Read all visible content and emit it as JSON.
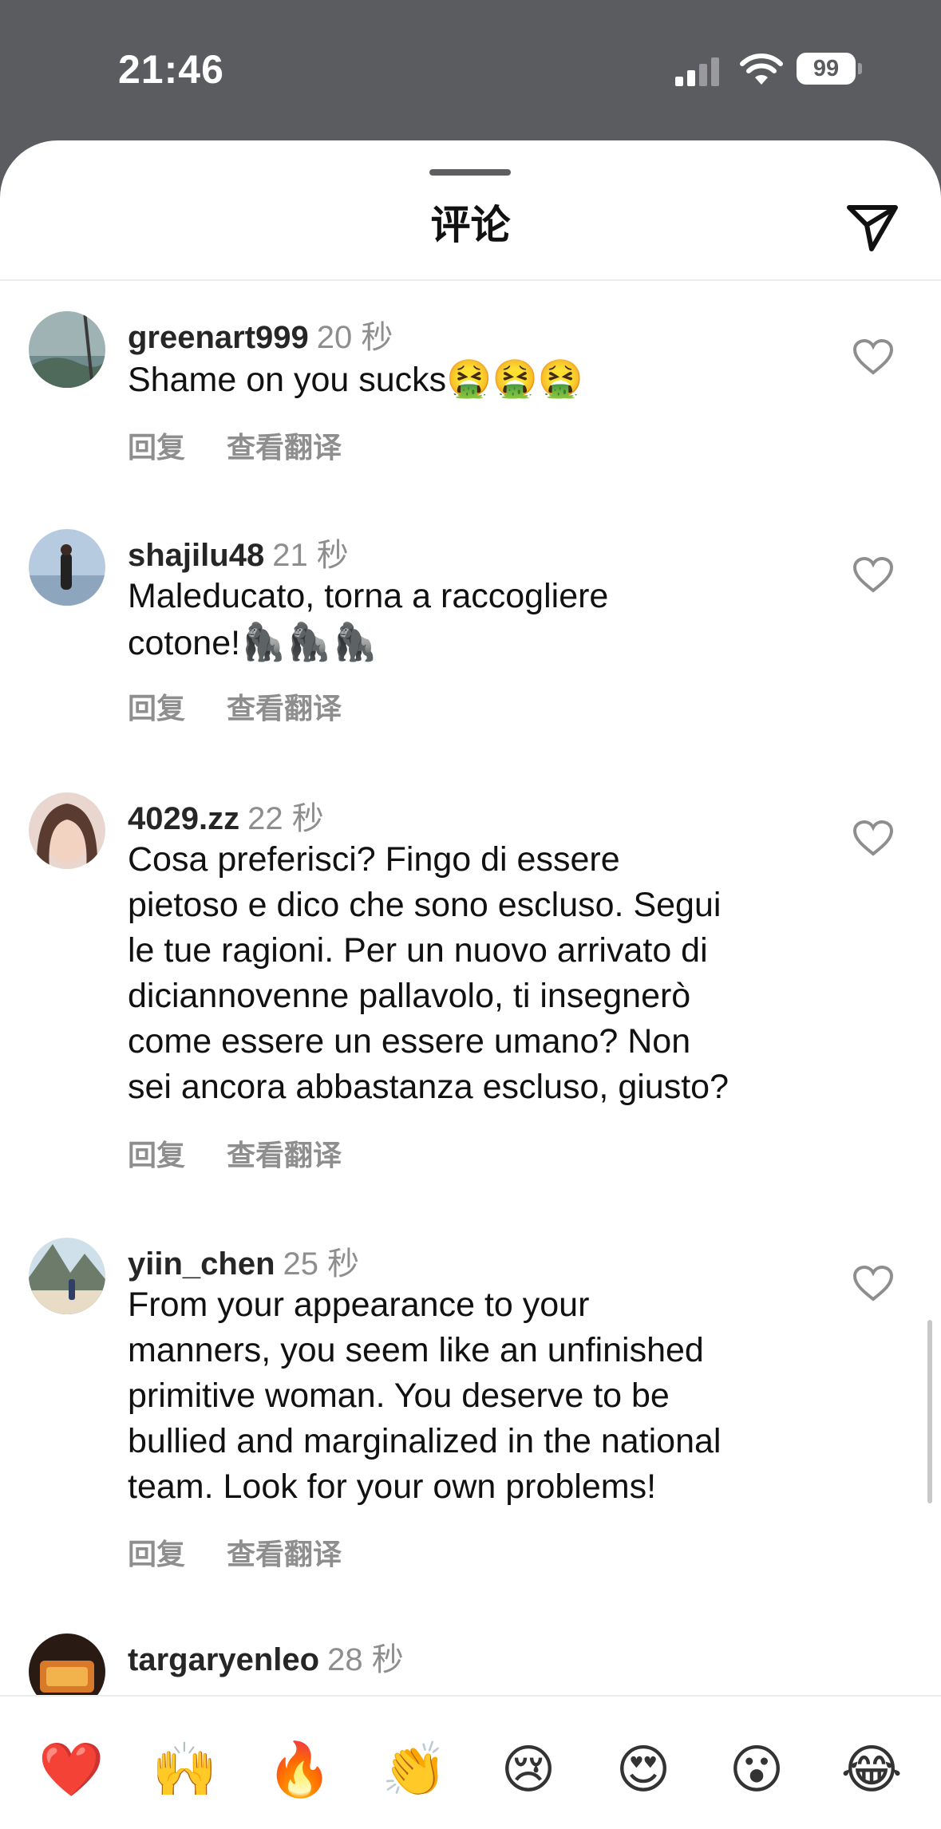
{
  "status_bar": {
    "time": "21:46",
    "battery_level": "99"
  },
  "sheet": {
    "title": "评论",
    "send_icon": "paper-plane-icon"
  },
  "comments": [
    {
      "username": "greenart999",
      "time": "20 秒",
      "text": [
        "Shame on you sucks"
      ],
      "emoji": "🤮🤮🤮",
      "reply": "回复",
      "translate": "查看翻译"
    },
    {
      "username": "shajilu48",
      "time": "21 秒",
      "text": [
        "Maleducato, torna a raccogliere",
        "cotone!"
      ],
      "emoji": "🦍🦍🦍",
      "reply": "回复",
      "translate": "查看翻译"
    },
    {
      "username": "4029.zz",
      "time": "22 秒",
      "text": [
        "Cosa preferisci? Fingo di essere",
        "pietoso e dico che sono escluso. Segui",
        "le tue ragioni. Per un nuovo arrivato di",
        "diciannovenne pallavolo, ti insegnerò",
        "come essere un essere umano? Non",
        "sei ancora abbastanza escluso, giusto?"
      ],
      "reply": "回复",
      "translate": "查看翻译"
    },
    {
      "username": "yiin_chen",
      "time": "25 秒",
      "text": [
        "From your appearance to your",
        "manners, you seem like an unfinished",
        "primitive woman. You deserve to be",
        "bullied and marginalized in the national",
        "team. Look for your own problems!"
      ],
      "reply": "回复",
      "translate": "查看翻译"
    },
    {
      "username": "targaryenleo",
      "time": "28 秒"
    }
  ],
  "reactions": [
    "❤️",
    "🙌",
    "🔥",
    "👏",
    "😢",
    "😍",
    "😮",
    "😂"
  ]
}
